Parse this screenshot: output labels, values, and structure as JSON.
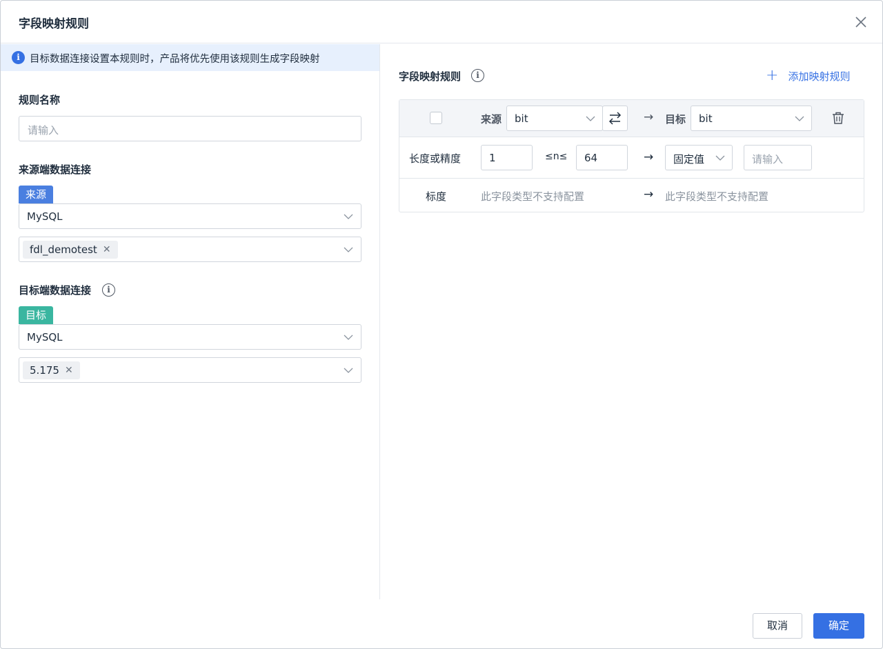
{
  "dialog": {
    "title": "字段映射规则",
    "close_icon": "close-icon"
  },
  "left": {
    "notice": "目标数据连接设置本规则时，产品将优先使用该规则生成字段映射",
    "rule_name": {
      "label": "规则名称",
      "placeholder": "请输入"
    },
    "source": {
      "label": "来源端数据连接",
      "badge": "来源",
      "db_type": "MySQL",
      "connection_tag": "fdl_demotest"
    },
    "target": {
      "label": "目标端数据连接",
      "badge": "目标",
      "db_type": "MySQL",
      "connection_tag": "5.175"
    }
  },
  "right": {
    "title": "字段映射规则",
    "add_label": "添加映射规则",
    "rule": {
      "source_label": "来源",
      "source_type": "bit",
      "target_label": "目标",
      "target_type": "bit",
      "length_label": "长度或精度",
      "min": "1",
      "between": "≤n≤",
      "max": "64",
      "mode": "固定值",
      "value_placeholder": "请输入",
      "scale_label": "标度",
      "source_scale_note": "此字段类型不支持配置",
      "target_scale_note": "此字段类型不支持配置"
    }
  },
  "footer": {
    "cancel": "取消",
    "ok": "确定"
  },
  "colors": {
    "accent": "#3570e3",
    "source_badge": "#4a7fe0",
    "target_badge": "#3ab6a0",
    "notice_bg": "#e7f0fd"
  }
}
